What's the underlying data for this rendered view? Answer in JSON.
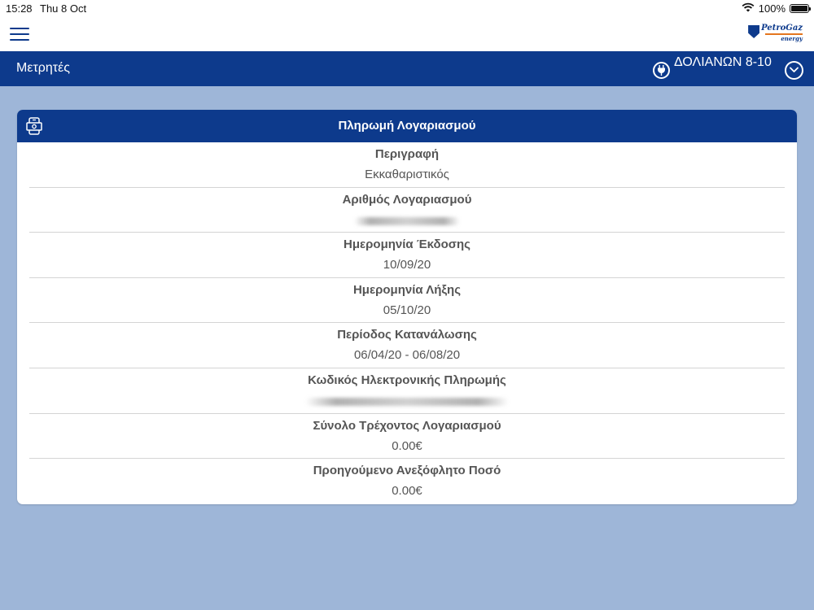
{
  "status_bar": {
    "time": "15:28",
    "date": "Thu 8 Oct",
    "battery": "100%"
  },
  "header": {
    "logo_name": "PetroGaz",
    "logo_sub": "energy",
    "menu_icon": "hamburger-icon"
  },
  "nav": {
    "title": "Μετρητές",
    "meter_name": "ΔΟΛΙΑΝΩΝ 8-10",
    "meter_icon": "plug-icon",
    "dropdown_icon": "chevron-down-icon"
  },
  "card": {
    "title": "Πληρωμή Λογαριασμού",
    "icon": "mobile-payment-icon",
    "rows": [
      {
        "label": "Περιγραφή",
        "value": "Εκκαθαριστικός",
        "redacted": false
      },
      {
        "label": "Αριθμός Λογαριασμού",
        "value": "",
        "redacted": true
      },
      {
        "label": "Ημερομηνία Έκδοσης",
        "value": "10/09/20",
        "redacted": false
      },
      {
        "label": "Ημερομηνία Λήξης",
        "value": "05/10/20",
        "redacted": false
      },
      {
        "label": "Περίοδος Κατανάλωσης",
        "value": "06/04/20 - 06/08/20",
        "redacted": false
      },
      {
        "label": "Κωδικός Ηλεκτρονικής Πληρωμής",
        "value": "",
        "redacted": true
      },
      {
        "label": "Σύνολο Τρέχοντος Λογαριασμού",
        "value": "0.00€",
        "redacted": false
      },
      {
        "label": "Προηγούμενο Ανεξόφλητο Ποσό",
        "value": "0.00€",
        "redacted": false
      }
    ]
  },
  "colors": {
    "primary": "#0d3a8c",
    "background": "#9eb6d8",
    "accent": "#e4761e"
  }
}
